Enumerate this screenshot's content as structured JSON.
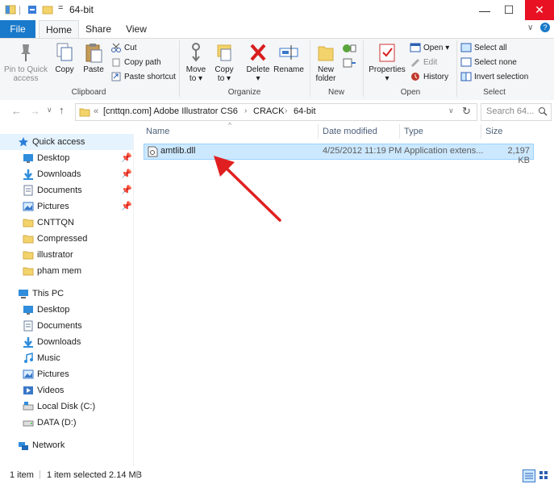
{
  "window": {
    "title": "64-bit",
    "qat_dropdown": "=",
    "minimize": "—",
    "maximize": "☐",
    "close": "✕"
  },
  "ribbon_tabs": [
    "File",
    "Home",
    "Share",
    "View"
  ],
  "clipboard": {
    "pin_label": "Pin to Quick access",
    "copy_label": "Copy",
    "paste_label": "Paste",
    "cut_label": "Cut",
    "copy_path_label": "Copy path",
    "paste_shortcut_label": "Paste shortcut",
    "group_label": "Clipboard"
  },
  "organize": {
    "move_label": "Move to ▾",
    "copy_to_label": "Copy to ▾",
    "delete_label": "Delete ▾",
    "rename_label": "Rename",
    "group_label": "Organize"
  },
  "new": {
    "new_folder_label": "New folder",
    "group_label": "New"
  },
  "open": {
    "properties_label": "Properties ▾",
    "open_label": "Open ▾",
    "edit_label": "Edit",
    "history_label": "History",
    "group_label": "Open"
  },
  "select": {
    "select_all_label": "Select all",
    "select_none_label": "Select none",
    "invert_label": "Invert selection",
    "group_label": "Select"
  },
  "address": {
    "prefix": "«",
    "crumbs": [
      "[cnttqn.com] Adobe Illustrator CS6",
      "CRACK",
      "64-bit"
    ],
    "search_placeholder": "Search 64..."
  },
  "sidebar": {
    "quick_access": "Quick access",
    "quick_items": [
      "Desktop",
      "Downloads",
      "Documents",
      "Pictures",
      "CNTTQN",
      "Compressed",
      "illustrator",
      "pham mem"
    ],
    "this_pc": "This PC",
    "pc_items": [
      "Desktop",
      "Documents",
      "Downloads",
      "Music",
      "Pictures",
      "Videos",
      "Local Disk (C:)",
      "DATA (D:)"
    ],
    "network": "Network"
  },
  "columns": {
    "name": "Name",
    "date": "Date modified",
    "type": "Type",
    "size": "Size"
  },
  "files": [
    {
      "name": "amtlib.dll",
      "date": "4/25/2012 11:19 PM",
      "type": "Application extens...",
      "size": "2,197 KB"
    }
  ],
  "status": {
    "count": "1 item",
    "selected": "1 item selected  2.14 MB"
  },
  "colors": {
    "accent": "#1979ca",
    "selection": "#cce8ff",
    "close": "#e81123",
    "arrow": "#e02020"
  }
}
